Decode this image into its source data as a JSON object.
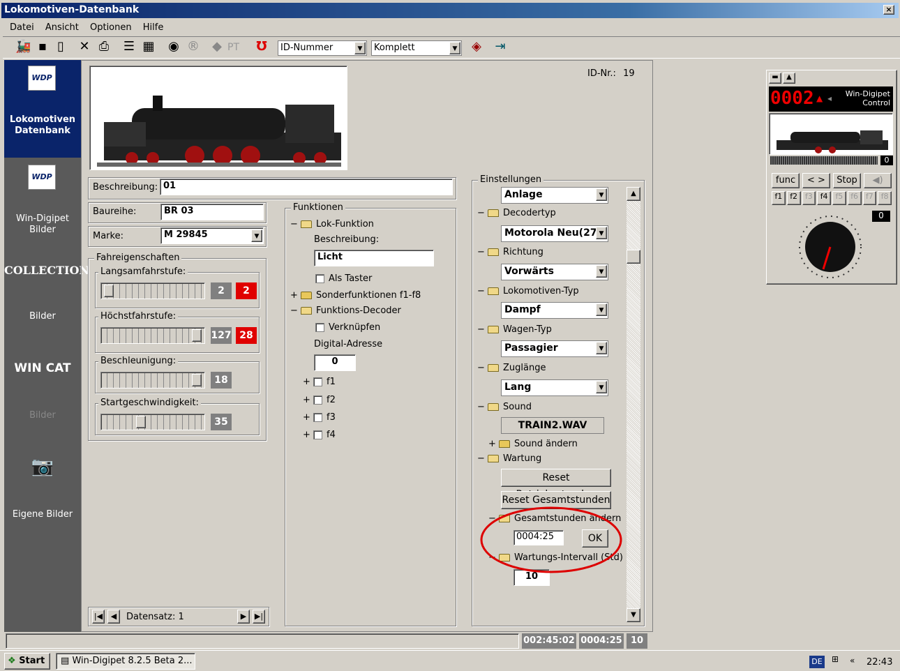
{
  "window": {
    "title": "Lokomotiven-Datenbank",
    "close": "×"
  },
  "menu": [
    "Datei",
    "Ansicht",
    "Optionen",
    "Hilfe"
  ],
  "toolbar": {
    "pt_label": "PT",
    "sort_field": "ID-Nummer",
    "filter": "Komplett"
  },
  "sidebar": {
    "logo_text": "WDP",
    "items": [
      {
        "label": "Lokomotiven\nDatenbank"
      },
      {
        "label": "Win-Digipet\nBilder"
      },
      {
        "label": "COLLECTION"
      },
      {
        "label": "Bilder"
      },
      {
        "label": "WIN CAT"
      },
      {
        "label": "Bilder"
      },
      {
        "label": "Eigene Bilder"
      }
    ]
  },
  "record": {
    "id_label": "ID-Nr.:",
    "id_value": "19",
    "beschreibung_label": "Beschreibung:",
    "beschreibung": "01",
    "baureihe_label": "Baureihe:",
    "baureihe": "BR 03",
    "marke_label": "Marke:",
    "marke": "M 29845"
  },
  "fahreigenschaften": {
    "label": "Fahreigenschaften",
    "langsam_label": "Langsamfahrstufe:",
    "langsam_a": "2",
    "langsam_b": "2",
    "hoechst_label": "Höchstfahrstufe:",
    "hoechst_a": "127",
    "hoechst_b": "28",
    "beschl_label": "Beschleunigung:",
    "beschl": "18",
    "start_label": "Startgeschwindigkeit:",
    "start": "35"
  },
  "navigator": {
    "label": "Datensatz: 1"
  },
  "funktionen": {
    "label": "Funktionen",
    "lok_funktion": "Lok-Funktion",
    "beschreibung_label": "Beschreibung:",
    "beschreibung": "Licht",
    "als_taster": "Als Taster",
    "sonder": "Sonderfunktionen f1-f8",
    "decoder": "Funktions-Decoder",
    "verknuepfen": "Verknüpfen",
    "digital_label": "Digital-Adresse",
    "digital": "0",
    "f": [
      "f1",
      "f2",
      "f3",
      "f4"
    ]
  },
  "einstellungen": {
    "label": "Einstellungen",
    "anlage": "Anlage",
    "decodertyp": "Decodertyp",
    "decodertyp_val": "Motorola Neu(27)",
    "richtung": "Richtung",
    "richtung_val": "Vorwärts",
    "lok_typ": "Lokomotiven-Typ",
    "lok_typ_val": "Dampf",
    "wagen_typ": "Wagen-Typ",
    "wagen_typ_val": "Passagier",
    "zuglaenge": "Zuglänge",
    "zuglaenge_val": "Lang",
    "sound": "Sound",
    "sound_val": "TRAIN2.WAV",
    "sound_aendern": "Sound ändern",
    "wartung": "Wartung",
    "reset_betrieb": "Reset Betriebsstunden",
    "reset_gesamt": "Reset Gesamtstunden",
    "gesamt_aendern": "Gesamtstunden ändern",
    "gesamt_val": "0004:25",
    "ok": "OK",
    "intervall": "Wartungs-Intervall (Std)",
    "intervall_val": "10"
  },
  "statusbar": {
    "time1": "002:45:02",
    "time2": "0004:25",
    "count": "10"
  },
  "control": {
    "address": "0002",
    "brand": "Win-Digipet\nControl",
    "speed": "0",
    "func": "func",
    "arrows": "< >",
    "stop": "Stop",
    "fkeys": [
      "f1",
      "f2",
      "f3",
      "f4",
      "f5",
      "f6",
      "f7",
      "f8"
    ],
    "step": "0"
  },
  "taskbar": {
    "start": "Start",
    "task": "Win-Digipet 8.2.5 Beta 2...",
    "lang": "DE",
    "clock": "22:43"
  }
}
